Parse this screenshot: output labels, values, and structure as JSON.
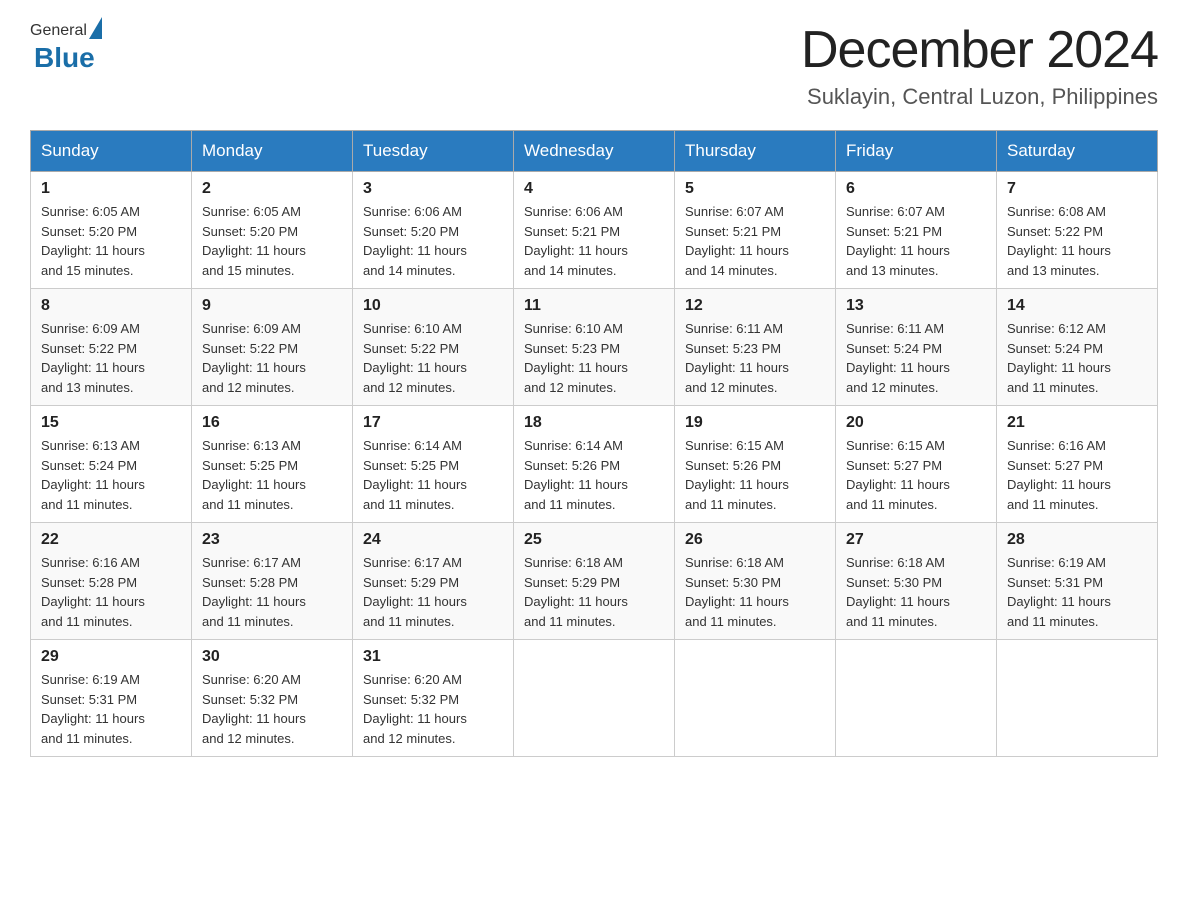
{
  "header": {
    "logo_general": "General",
    "logo_blue": "Blue",
    "month_title": "December 2024",
    "location": "Suklayin, Central Luzon, Philippines"
  },
  "days_of_week": [
    "Sunday",
    "Monday",
    "Tuesday",
    "Wednesday",
    "Thursday",
    "Friday",
    "Saturday"
  ],
  "weeks": [
    [
      {
        "day": "1",
        "sunrise": "6:05 AM",
        "sunset": "5:20 PM",
        "daylight": "11 hours and 15 minutes."
      },
      {
        "day": "2",
        "sunrise": "6:05 AM",
        "sunset": "5:20 PM",
        "daylight": "11 hours and 15 minutes."
      },
      {
        "day": "3",
        "sunrise": "6:06 AM",
        "sunset": "5:20 PM",
        "daylight": "11 hours and 14 minutes."
      },
      {
        "day": "4",
        "sunrise": "6:06 AM",
        "sunset": "5:21 PM",
        "daylight": "11 hours and 14 minutes."
      },
      {
        "day": "5",
        "sunrise": "6:07 AM",
        "sunset": "5:21 PM",
        "daylight": "11 hours and 14 minutes."
      },
      {
        "day": "6",
        "sunrise": "6:07 AM",
        "sunset": "5:21 PM",
        "daylight": "11 hours and 13 minutes."
      },
      {
        "day": "7",
        "sunrise": "6:08 AM",
        "sunset": "5:22 PM",
        "daylight": "11 hours and 13 minutes."
      }
    ],
    [
      {
        "day": "8",
        "sunrise": "6:09 AM",
        "sunset": "5:22 PM",
        "daylight": "11 hours and 13 minutes."
      },
      {
        "day": "9",
        "sunrise": "6:09 AM",
        "sunset": "5:22 PM",
        "daylight": "11 hours and 12 minutes."
      },
      {
        "day": "10",
        "sunrise": "6:10 AM",
        "sunset": "5:22 PM",
        "daylight": "11 hours and 12 minutes."
      },
      {
        "day": "11",
        "sunrise": "6:10 AM",
        "sunset": "5:23 PM",
        "daylight": "11 hours and 12 minutes."
      },
      {
        "day": "12",
        "sunrise": "6:11 AM",
        "sunset": "5:23 PM",
        "daylight": "11 hours and 12 minutes."
      },
      {
        "day": "13",
        "sunrise": "6:11 AM",
        "sunset": "5:24 PM",
        "daylight": "11 hours and 12 minutes."
      },
      {
        "day": "14",
        "sunrise": "6:12 AM",
        "sunset": "5:24 PM",
        "daylight": "11 hours and 11 minutes."
      }
    ],
    [
      {
        "day": "15",
        "sunrise": "6:13 AM",
        "sunset": "5:24 PM",
        "daylight": "11 hours and 11 minutes."
      },
      {
        "day": "16",
        "sunrise": "6:13 AM",
        "sunset": "5:25 PM",
        "daylight": "11 hours and 11 minutes."
      },
      {
        "day": "17",
        "sunrise": "6:14 AM",
        "sunset": "5:25 PM",
        "daylight": "11 hours and 11 minutes."
      },
      {
        "day": "18",
        "sunrise": "6:14 AM",
        "sunset": "5:26 PM",
        "daylight": "11 hours and 11 minutes."
      },
      {
        "day": "19",
        "sunrise": "6:15 AM",
        "sunset": "5:26 PM",
        "daylight": "11 hours and 11 minutes."
      },
      {
        "day": "20",
        "sunrise": "6:15 AM",
        "sunset": "5:27 PM",
        "daylight": "11 hours and 11 minutes."
      },
      {
        "day": "21",
        "sunrise": "6:16 AM",
        "sunset": "5:27 PM",
        "daylight": "11 hours and 11 minutes."
      }
    ],
    [
      {
        "day": "22",
        "sunrise": "6:16 AM",
        "sunset": "5:28 PM",
        "daylight": "11 hours and 11 minutes."
      },
      {
        "day": "23",
        "sunrise": "6:17 AM",
        "sunset": "5:28 PM",
        "daylight": "11 hours and 11 minutes."
      },
      {
        "day": "24",
        "sunrise": "6:17 AM",
        "sunset": "5:29 PM",
        "daylight": "11 hours and 11 minutes."
      },
      {
        "day": "25",
        "sunrise": "6:18 AM",
        "sunset": "5:29 PM",
        "daylight": "11 hours and 11 minutes."
      },
      {
        "day": "26",
        "sunrise": "6:18 AM",
        "sunset": "5:30 PM",
        "daylight": "11 hours and 11 minutes."
      },
      {
        "day": "27",
        "sunrise": "6:18 AM",
        "sunset": "5:30 PM",
        "daylight": "11 hours and 11 minutes."
      },
      {
        "day": "28",
        "sunrise": "6:19 AM",
        "sunset": "5:31 PM",
        "daylight": "11 hours and 11 minutes."
      }
    ],
    [
      {
        "day": "29",
        "sunrise": "6:19 AM",
        "sunset": "5:31 PM",
        "daylight": "11 hours and 11 minutes."
      },
      {
        "day": "30",
        "sunrise": "6:20 AM",
        "sunset": "5:32 PM",
        "daylight": "11 hours and 12 minutes."
      },
      {
        "day": "31",
        "sunrise": "6:20 AM",
        "sunset": "5:32 PM",
        "daylight": "11 hours and 12 minutes."
      },
      null,
      null,
      null,
      null
    ]
  ],
  "labels": {
    "sunrise": "Sunrise:",
    "sunset": "Sunset:",
    "daylight": "Daylight:"
  }
}
